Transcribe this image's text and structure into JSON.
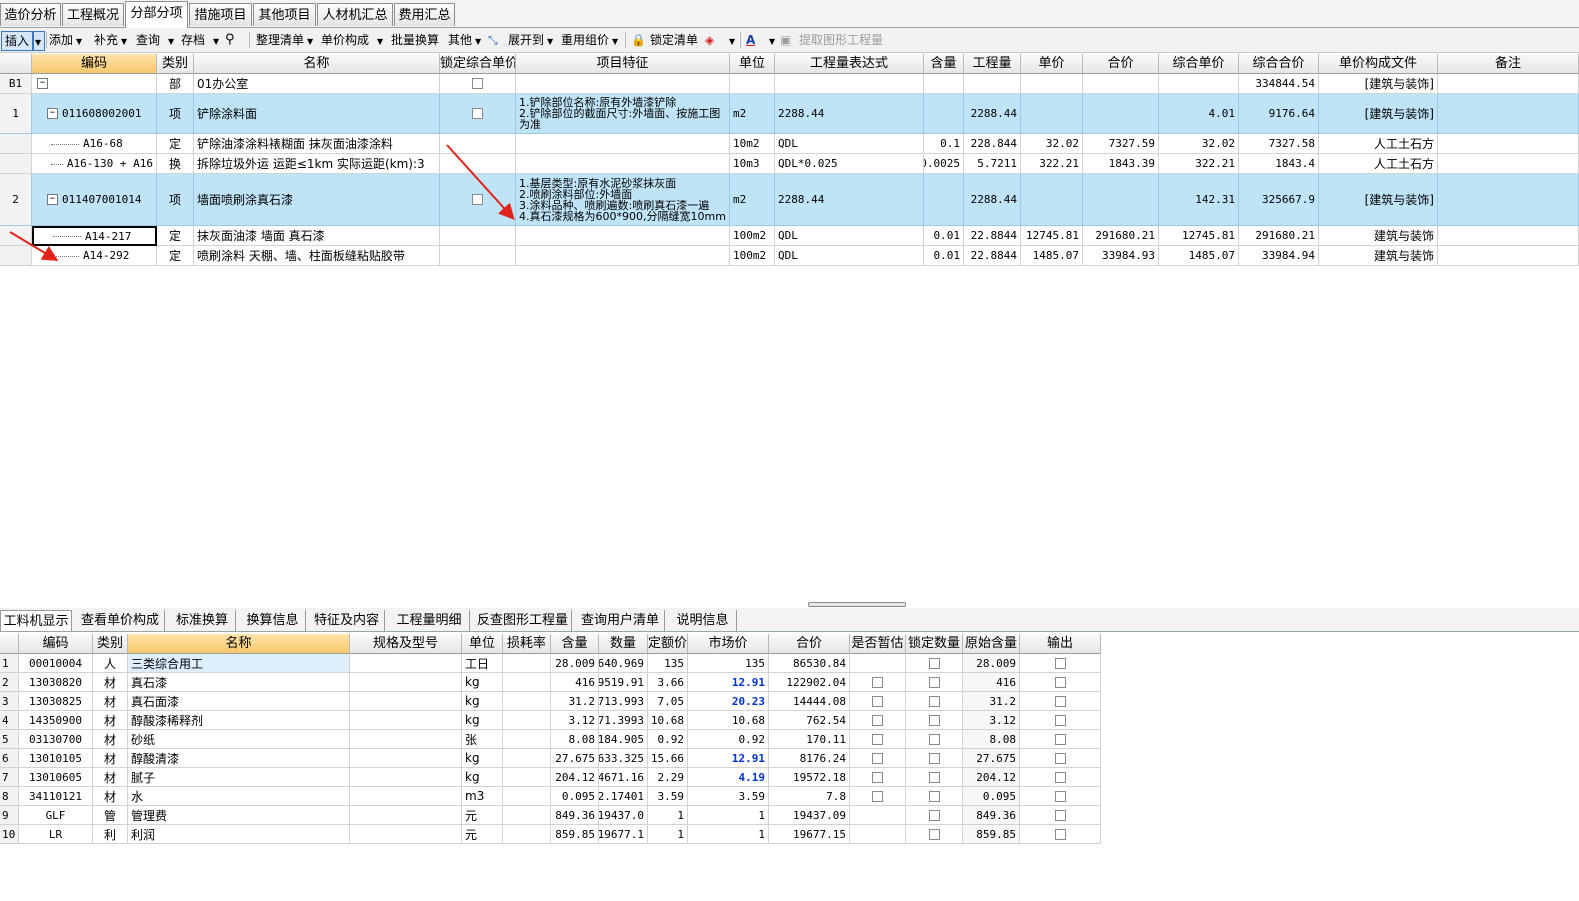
{
  "top_tabs": [
    "造价分析",
    "工程概况",
    "分部分项",
    "措施项目",
    "其他项目",
    "人材机汇总",
    "费用汇总"
  ],
  "toolbar": {
    "insert": "插入",
    "add": "添加",
    "supplement": "补充",
    "query": "查询",
    "archive": "存档",
    "organize": "整理清单",
    "unit_comp": "单价构成",
    "batch": "批量换算",
    "other": "其他",
    "expand": "展开到",
    "reuse": "重用组价",
    "lock": "锁定清单",
    "extract": "提取图形工程量"
  },
  "main_headers": [
    "编码",
    "类别",
    "名称",
    "锁定综合单价",
    "项目特征",
    "单位",
    "工程量表达式",
    "含量",
    "工程量",
    "单价",
    "合价",
    "综合单价",
    "综合合价",
    "单价构成文件",
    "备注"
  ],
  "main_rows": [
    {
      "num": "B1",
      "code": "",
      "type": "部",
      "name": "01办公室",
      "lock": true,
      "feature": "",
      "unit": "",
      "expr": "",
      "content": "",
      "qty": "",
      "price": "",
      "total": "",
      "comp_price": "",
      "comp_total": "334844.54",
      "file": "[建筑与装饰]",
      "note": ""
    },
    {
      "num": "1",
      "code": "011608002001",
      "type": "项",
      "name": "铲除涂料面",
      "lock": true,
      "feature": "1.铲除部位名称:原有外墙漆铲除\n2.铲除部位的截面尺寸:外墙面、按施工图为准",
      "unit": "m2",
      "expr": "2288.44",
      "content": "",
      "qty": "2288.44",
      "price": "",
      "total": "",
      "comp_price": "4.01",
      "comp_total": "9176.64",
      "file": "[建筑与装饰]",
      "note": ""
    },
    {
      "num": "",
      "code": "A16-68",
      "type": "定",
      "name": "铲除油漆涂料裱糊面 抹灰面油漆涂料",
      "lock": false,
      "feature": "",
      "unit": "10m2",
      "expr": "QDL",
      "content": "0.1",
      "qty": "228.844",
      "price": "32.02",
      "total": "7327.59",
      "comp_price": "32.02",
      "comp_total": "7327.58",
      "file": "人工土石方",
      "note": ""
    },
    {
      "num": "",
      "code": "A16-130 + A16",
      "type": "换",
      "name": "拆除垃圾外运 运距≤1km  实际运距(km):3",
      "lock": false,
      "feature": "",
      "unit": "10m3",
      "expr": "QDL*0.025",
      "content": "0.0025",
      "qty": "5.7211",
      "price": "322.21",
      "total": "1843.39",
      "comp_price": "322.21",
      "comp_total": "1843.4",
      "file": "人工土石方",
      "note": ""
    },
    {
      "num": "2",
      "code": "011407001014",
      "type": "项",
      "name": "墙面喷刷涂真石漆",
      "lock": true,
      "feature": "1.基层类型:原有水泥砂浆抹灰面\n2.喷刷涂料部位:外墙面\n3.涂料品种、喷刷遍数:喷刷真石漆一遍\n4.真石漆规格为600*900,分隔缝宽10mm",
      "unit": "m2",
      "expr": "2288.44",
      "content": "",
      "qty": "2288.44",
      "price": "",
      "total": "",
      "comp_price": "142.31",
      "comp_total": "325667.9",
      "file": "[建筑与装饰]",
      "note": ""
    },
    {
      "num": "",
      "code": "A14-217",
      "type": "定",
      "name": "抹灰面油漆 墙面 真石漆",
      "lock": false,
      "feature": "",
      "unit": "100m2",
      "expr": "QDL",
      "content": "0.01",
      "qty": "22.8844",
      "price": "12745.81",
      "total": "291680.21",
      "comp_price": "12745.81",
      "comp_total": "291680.21",
      "file": "建筑与装饰",
      "note": ""
    },
    {
      "num": "",
      "code": "A14-292",
      "type": "定",
      "name": "喷刷涂料 天棚、墙、柱面板缝粘贴胶带",
      "lock": false,
      "feature": "",
      "unit": "100m2",
      "expr": "QDL",
      "content": "0.01",
      "qty": "22.8844",
      "price": "1485.07",
      "total": "33984.93",
      "comp_price": "1485.07",
      "comp_total": "33984.94",
      "file": "建筑与装饰",
      "note": ""
    }
  ],
  "bottom_tabs": [
    "工料机显示",
    "查看单价构成",
    "标准换算",
    "换算信息",
    "特征及内容",
    "工程量明细",
    "反查图形工程量",
    "查询用户清单",
    "说明信息"
  ],
  "bottom_headers": [
    "编码",
    "类别",
    "名称",
    "规格及型号",
    "单位",
    "损耗率",
    "含量",
    "数量",
    "定额价",
    "市场价",
    "合价",
    "是否暂估",
    "锁定数量",
    "原始含量",
    "输出"
  ],
  "bottom_rows": [
    {
      "num": "1",
      "code": "00010004",
      "type": "人",
      "name": "三类综合用工",
      "spec": "",
      "unit": "工日",
      "loss": "",
      "content": "28.009",
      "qty": "640.969",
      "quota": "135",
      "market": "135",
      "market_hl": false,
      "total": "86530.84",
      "est": null,
      "orig": "28.009"
    },
    {
      "num": "2",
      "code": "13030820",
      "type": "材",
      "name": "真石漆",
      "spec": "",
      "unit": "kg",
      "loss": "",
      "content": "416",
      "qty": "9519.91",
      "quota": "3.66",
      "market": "12.91",
      "market_hl": true,
      "total": "122902.04",
      "est": false,
      "orig": "416"
    },
    {
      "num": "3",
      "code": "13030825",
      "type": "材",
      "name": "真石面漆",
      "spec": "",
      "unit": "kg",
      "loss": "",
      "content": "31.2",
      "qty": "713.993",
      "quota": "7.05",
      "market": "20.23",
      "market_hl": true,
      "total": "14444.08",
      "est": false,
      "orig": "31.2"
    },
    {
      "num": "4",
      "code": "14350900",
      "type": "材",
      "name": "醇酸漆稀释剂",
      "spec": "",
      "unit": "kg",
      "loss": "",
      "content": "3.12",
      "qty": "71.3993",
      "quota": "10.68",
      "market": "10.68",
      "market_hl": false,
      "total": "762.54",
      "est": false,
      "orig": "3.12"
    },
    {
      "num": "5",
      "code": "03130700",
      "type": "材",
      "name": "砂纸",
      "spec": "",
      "unit": "张",
      "loss": "",
      "content": "8.08",
      "qty": "184.905",
      "quota": "0.92",
      "market": "0.92",
      "market_hl": false,
      "total": "170.11",
      "est": false,
      "orig": "8.08"
    },
    {
      "num": "6",
      "code": "13010105",
      "type": "材",
      "name": "醇酸清漆",
      "spec": "",
      "unit": "kg",
      "loss": "",
      "content": "27.675",
      "qty": "633.325",
      "quota": "15.66",
      "market": "12.91",
      "market_hl": true,
      "total": "8176.24",
      "est": false,
      "orig": "27.675"
    },
    {
      "num": "7",
      "code": "13010605",
      "type": "材",
      "name": "腻子",
      "spec": "",
      "unit": "kg",
      "loss": "",
      "content": "204.12",
      "qty": "4671.16",
      "quota": "2.29",
      "market": "4.19",
      "market_hl": true,
      "total": "19572.18",
      "est": false,
      "orig": "204.12"
    },
    {
      "num": "8",
      "code": "34110121",
      "type": "材",
      "name": "水",
      "spec": "",
      "unit": "m3",
      "loss": "",
      "content": "0.095",
      "qty": "2.17401",
      "quota": "3.59",
      "market": "3.59",
      "market_hl": false,
      "total": "7.8",
      "est": false,
      "orig": "0.095"
    },
    {
      "num": "9",
      "code": "GLF",
      "type": "管",
      "name": "管理费",
      "spec": "",
      "unit": "元",
      "loss": "",
      "content": "849.36",
      "qty": "19437.0",
      "quota": "1",
      "market": "1",
      "market_hl": false,
      "total": "19437.09",
      "est": null,
      "orig": "849.36"
    },
    {
      "num": "10",
      "code": "LR",
      "type": "利",
      "name": "利润",
      "spec": "",
      "unit": "元",
      "loss": "",
      "content": "859.85",
      "qty": "19677.1",
      "quota": "1",
      "market": "1",
      "market_hl": false,
      "total": "19677.15",
      "est": null,
      "orig": "859.85"
    }
  ],
  "colors": {
    "blue_row": "#bfe3f7",
    "header_highlight": "#f6c86b",
    "market_highlight": "#0033cc",
    "annotation_arrow": "#e2231a"
  }
}
